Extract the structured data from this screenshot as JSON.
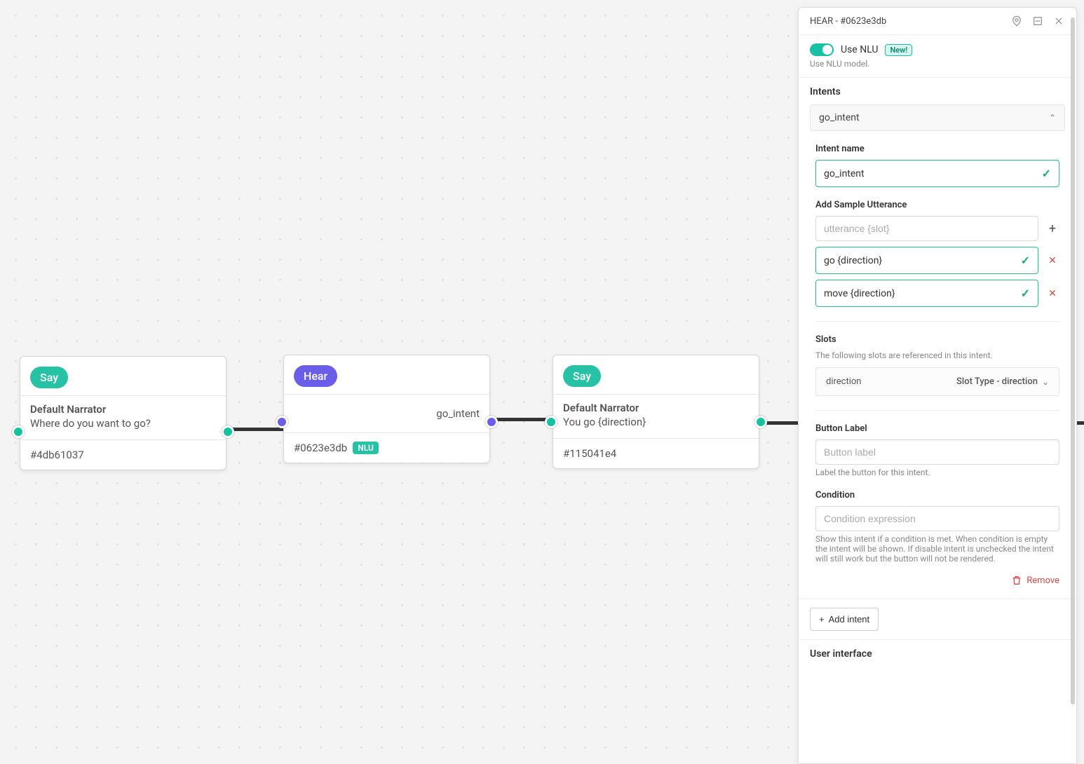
{
  "canvas": {
    "nodes": [
      {
        "kind": "say",
        "pill": "Say",
        "speaker": "Default Narrator",
        "text": "Where do you want to go?",
        "footer_id": "#4db61037"
      },
      {
        "kind": "hear",
        "pill": "Hear",
        "intent": "go_intent",
        "footer_id": "#0623e3db",
        "nlu_badge": "NLU"
      },
      {
        "kind": "say",
        "pill": "Say",
        "speaker": "Default Narrator",
        "text": "You go {direction}",
        "footer_id": "#115041e4"
      }
    ]
  },
  "panel": {
    "title": "HEAR - #0623e3db",
    "nlu": {
      "toggle_label": "Use NLU",
      "badge": "New!",
      "hint": "Use NLU model."
    },
    "intents_header": "Intents",
    "intent_selected": "go_intent",
    "intent_name_label": "Intent name",
    "intent_name_value": "go_intent",
    "utterance_label": "Add Sample Utterance",
    "utterance_placeholder": "utterance {slot}",
    "utterances": [
      "go {direction}",
      "move {direction}"
    ],
    "slots_header": "Slots",
    "slots_desc": "The following slots are referenced in this intent.",
    "slot_name": "direction",
    "slot_type": "Slot Type - direction",
    "button_label_header": "Button Label",
    "button_label_placeholder": "Button label",
    "button_label_hint": "Label the button for this intent.",
    "condition_header": "Condition",
    "condition_placeholder": "Condition expression",
    "condition_hint": "Show this intent if a condition is met. When condition is empty the intent will be shown. If disable intent is unchecked the intent will still work but the button will not be rendered.",
    "remove_label": "Remove",
    "add_intent_label": "Add intent",
    "ui_header": "User interface"
  }
}
